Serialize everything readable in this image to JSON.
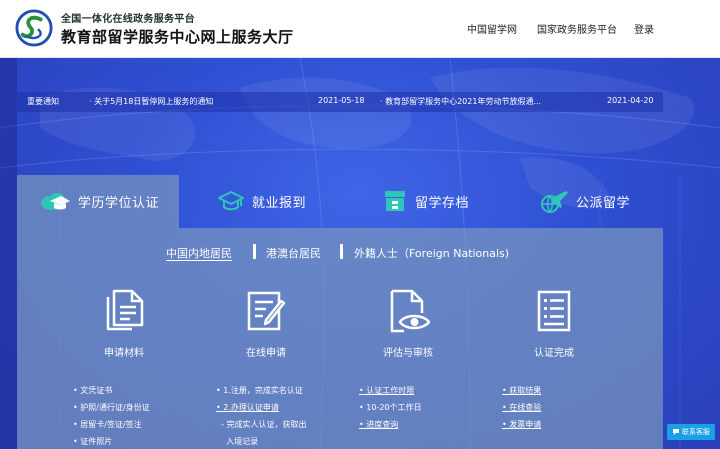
{
  "header": {
    "brand_top": "全国一体化在线政务服务平台",
    "brand_main": "教育部留学服务中心网上服务大厅",
    "nav": [
      "中国留学网",
      "国家政务服务平台",
      "登录"
    ]
  },
  "notice": {
    "label": "重要通知",
    "items": [
      {
        "title": "· 关于5月18日暂停网上服务的通知",
        "date": "2021-05-18"
      },
      {
        "title": "· 教育部留学服务中心2021年劳动节放假通...",
        "date": "2021-04-20"
      }
    ]
  },
  "tabs": [
    {
      "label": "学历学位认证",
      "icon": "graduation-cap-cloud-icon",
      "active": true
    },
    {
      "label": "就业报到",
      "icon": "graduation-cap-icon",
      "active": false
    },
    {
      "label": "留学存档",
      "icon": "archive-icon",
      "active": false
    },
    {
      "label": "公派留学",
      "icon": "airplane-globe-icon",
      "active": false
    }
  ],
  "segments": [
    {
      "label": "中国内地居民",
      "active": true
    },
    {
      "label": "港澳台居民",
      "active": false
    },
    {
      "label": "外籍人士（Foreign Nationals)",
      "active": false
    }
  ],
  "steps": [
    {
      "title": "申请材料",
      "icon": "documents-icon",
      "items": [
        "• 文凭证书",
        "• 护照/通行证/身份证",
        "• 居留卡/签证/签注",
        "• 证件照片"
      ]
    },
    {
      "title": "在线申请",
      "icon": "edit-form-icon",
      "items": [
        "• 1.注册，完成实名认证",
        "• 2.办理认证申请",
        "  - 完成实人认证，获取出",
        "    入境记录"
      ]
    },
    {
      "title": "评估与审核",
      "icon": "document-eye-icon",
      "items": [
        "• 认证工作时限",
        "• 10-20个工作日",
        "• 进度查询"
      ]
    },
    {
      "title": "认证完成",
      "icon": "certificate-list-icon",
      "items": [
        "• 获取结果",
        "• 在线查验",
        "• 发票申请"
      ]
    }
  ],
  "customer_service": "联系客服",
  "colors": {
    "brand_blue": "#2f49c9",
    "panel": "#7896be",
    "accent_teal": "#2ec7b6",
    "service_button": "#1aa0e6"
  }
}
